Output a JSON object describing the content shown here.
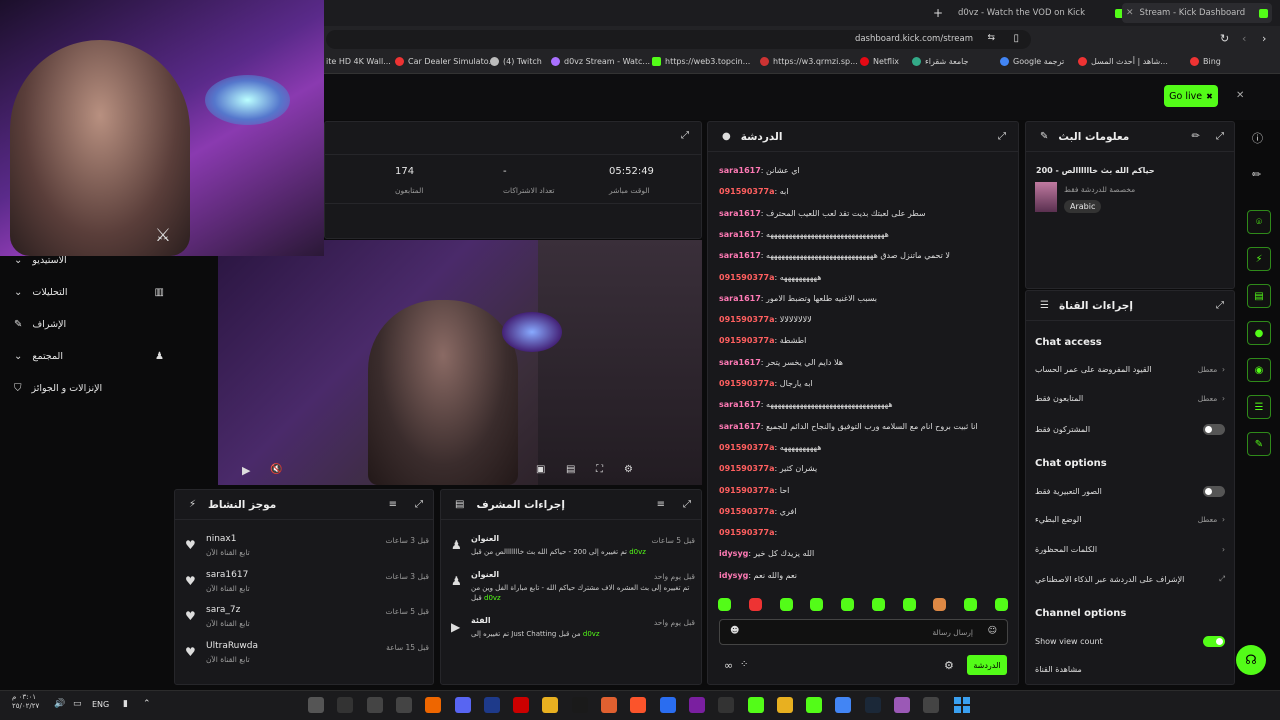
{
  "browser": {
    "tabs": [
      {
        "label": "d0vz - Watch the VOD on Kick"
      },
      {
        "label": "Stream - Kick Dashboard"
      }
    ],
    "url": "dashboard.kick.com/stream",
    "bookmarks": [
      "ite HD 4K Wall...",
      "Car Dealer Simulato...",
      "(4) Twitch",
      "d0vz Stream - Watc...",
      "https://web3.topcin...",
      "https://w3.qrmzi.sp...",
      "Netflix",
      "جامعة شقراء",
      "Google ترجمة",
      "شاهد | أحدث المسل...",
      "Bing"
    ]
  },
  "topnav": {
    "golive": "Go live"
  },
  "stats": {
    "viewers_value": "174",
    "viewers_label": "المتابعون",
    "subs_value": "-",
    "subs_label": "تعداد الاشتراكات",
    "time_value": "05:52:49",
    "time_label": "الوقت مباشر"
  },
  "leftnav": [
    {
      "label": "الاستيديو"
    },
    {
      "label": "التحليلات"
    },
    {
      "label": "الإشراف"
    },
    {
      "label": "المجتمع"
    },
    {
      "label": "الإنزالات و الجوائز"
    }
  ],
  "activity": {
    "title": "موجز النشاط",
    "items": [
      {
        "name": "ninax1",
        "sub": "تابع القناة الآن",
        "time": "قبل 3 ساعات"
      },
      {
        "name": "sara1617",
        "sub": "تابع القناة الآن",
        "time": "قبل 3 ساعات"
      },
      {
        "name": "sara_7z",
        "sub": "تابع القناة الآن",
        "time": "قبل 5 ساعات"
      },
      {
        "name": "UltraRuwda",
        "sub": "تابع القناة الآن",
        "time": "قبل 15 ساعة"
      }
    ]
  },
  "modactions": {
    "title": "إجراءات المشرف",
    "items": [
      {
        "label": "العنوان",
        "text": "تم تغييره إلى 200 - حياكم الله بث خااااااالص من قبل",
        "by": "d0vz",
        "time": "قبل 5 ساعات"
      },
      {
        "label": "العنوان",
        "text": "تم تغييره إلى بث العشره الاف مشترك حياكم الله - تابع مباراة الفل وين من قبل",
        "by": "d0vz",
        "time": "قبل يوم واحد"
      },
      {
        "label": "الفئة",
        "text": "تم تغييره إلى Just Chatting من قبل",
        "by": "d0vz",
        "time": "قبل يوم واحد"
      }
    ]
  },
  "chat": {
    "title": "الدردشة",
    "placeholder": "إرسال رسالة",
    "send": "الدردشة",
    "messages": [
      {
        "user": "sara1617",
        "text": "اي عشانن",
        "c": "pink"
      },
      {
        "user": "091590377a",
        "text": "ابه",
        "c": "red"
      },
      {
        "user": "sara1617",
        "text": "سطر على لعبتك بديت تقد لعب اللعيب المحترف",
        "c": "pink"
      },
      {
        "user": "sara1617",
        "text": "ههههههههههههههههههههههههههههههههه",
        "c": "pink"
      },
      {
        "user": "sara1617",
        "text": "لا تحمي ماتنزل صدق هههههههههههههههههههههههههههههه",
        "c": "pink"
      },
      {
        "user": "091590377a",
        "text": "ههههههههههه",
        "c": "red"
      },
      {
        "user": "sara1617",
        "text": "بسبب الاغنيه طلعها وتضبط الامور",
        "c": "pink"
      },
      {
        "user": "091590377a",
        "text": "لالالالالالالا",
        "c": "red"
      },
      {
        "user": "091590377a",
        "text": "اطشطة",
        "c": "red"
      },
      {
        "user": "sara1617",
        "text": "هلا دايم الي يخسر يتحر",
        "c": "pink"
      },
      {
        "user": "091590377a",
        "text": "ابه يارجال",
        "c": "red"
      },
      {
        "user": "sara1617",
        "text": "هههههههههههههههههههههههههههههههههه",
        "c": "pink"
      },
      {
        "user": "sara1617",
        "text": "انا ثبيت بروح انام مع السلامه ورب التوفيق والنجاح الدائم للجميع",
        "c": "pink"
      },
      {
        "user": "091590377a",
        "text": "ههههههههههه",
        "c": "red"
      },
      {
        "user": "091590377a",
        "text": "يشران كثير",
        "c": "red"
      },
      {
        "user": "091590377a",
        "text": "احا",
        "c": "red"
      },
      {
        "user": "091590377a",
        "text": "افري",
        "c": "red"
      },
      {
        "user": "091590377a",
        "text": "",
        "c": "red"
      },
      {
        "user": "idysyg",
        "text": "الله يزيدك كل خير",
        "c": "pink"
      },
      {
        "user": "idysyg",
        "text": "نعم والله نعم",
        "c": "pink"
      }
    ]
  },
  "streaminfo": {
    "title": "معلومات البث",
    "stream_title": "حياكم الله بث خاااااالص - 200",
    "sub": "مخصصة للدردشة فقط",
    "tag": "Arabic"
  },
  "channel": {
    "title": "إجراءات القناة",
    "chat_access": "Chat access",
    "acc1": "القيود المفروضة على عمر الحساب",
    "acc1v": "معطل",
    "acc2": "المتابعون فقط",
    "acc2v": "معطل",
    "acc3": "المشتركون فقط",
    "chat_options": "Chat options",
    "o1": "الصور التعبيرية فقط",
    "o2": "الوضع البطيء",
    "o2v": "معطل",
    "o3": "الكلمات المحظورة",
    "o4": "الإشراف على الدردشة عبر الذكاء الاصطناعي",
    "channel_options": "Channel options",
    "show_view": "Show view count",
    "watch": "مشاهدة القناة"
  },
  "taskbar": {
    "time": "٠٣:٠١ م",
    "date": "٢٥/٠٢/٢٧",
    "lang": "ENG"
  }
}
